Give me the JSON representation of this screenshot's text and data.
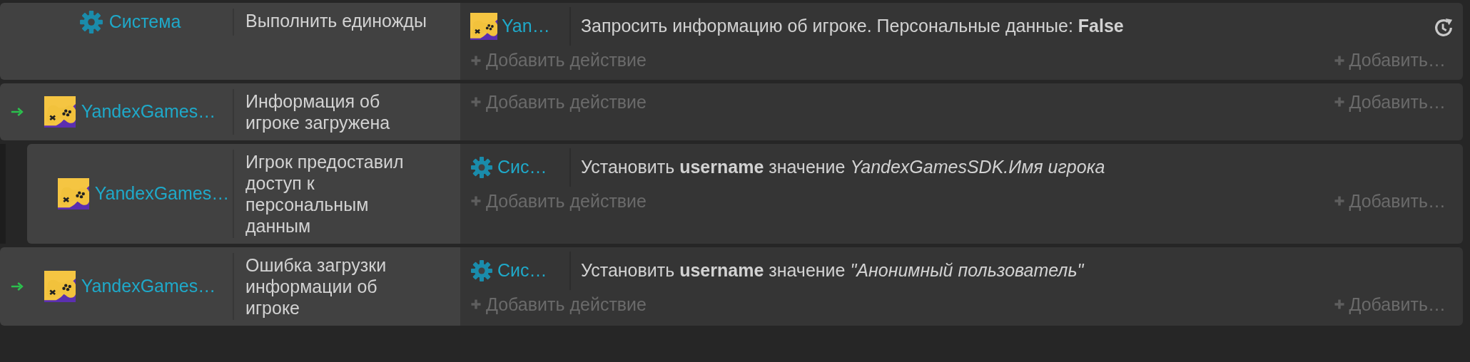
{
  "events": [
    {
      "trigger_arrow": false,
      "timer_icon": true,
      "conditions": [
        {
          "object": {
            "kind": "system",
            "name": "Система"
          },
          "text": "Выполнить единожды"
        }
      ],
      "actions": [
        {
          "object": {
            "kind": "extension",
            "name": "Yan…"
          },
          "text": "Запросить информацию об игроке. Персональные данные: **False**"
        }
      ],
      "add_action": "Добавить действие",
      "add_other": "Добавить…"
    },
    {
      "trigger_arrow": true,
      "timer_icon": false,
      "conditions": [
        {
          "object": {
            "kind": "extension",
            "name": "YandexGames…"
          },
          "text": "Информация об игроке загружена"
        }
      ],
      "add_action": "Добавить действие",
      "add_other": "Добавить…",
      "children": [
        {
          "trigger_arrow": false,
          "timer_icon": false,
          "conditions": [
            {
              "object": {
                "kind": "extension",
                "name": "YandexGames…"
              },
              "text": "Игрок предоставил доступ к персональным данным"
            }
          ],
          "actions": [
            {
              "object": {
                "kind": "system",
                "name": "Сис…"
              },
              "text": "Установить **username** значение *YandexGamesSDK.Имя игрока*"
            }
          ],
          "add_action": "Добавить действие",
          "add_other": "Добавить…"
        }
      ]
    },
    {
      "trigger_arrow": true,
      "timer_icon": false,
      "conditions": [
        {
          "object": {
            "kind": "extension",
            "name": "YandexGames…"
          },
          "text": "Ошибка загрузки информации об игроке"
        }
      ],
      "actions": [
        {
          "object": {
            "kind": "system",
            "name": "Сис…"
          },
          "text": "Установить **username** значение *\"Анонимный пользователь\"*"
        }
      ],
      "add_action": "Добавить действие",
      "add_other": "Добавить…"
    }
  ]
}
